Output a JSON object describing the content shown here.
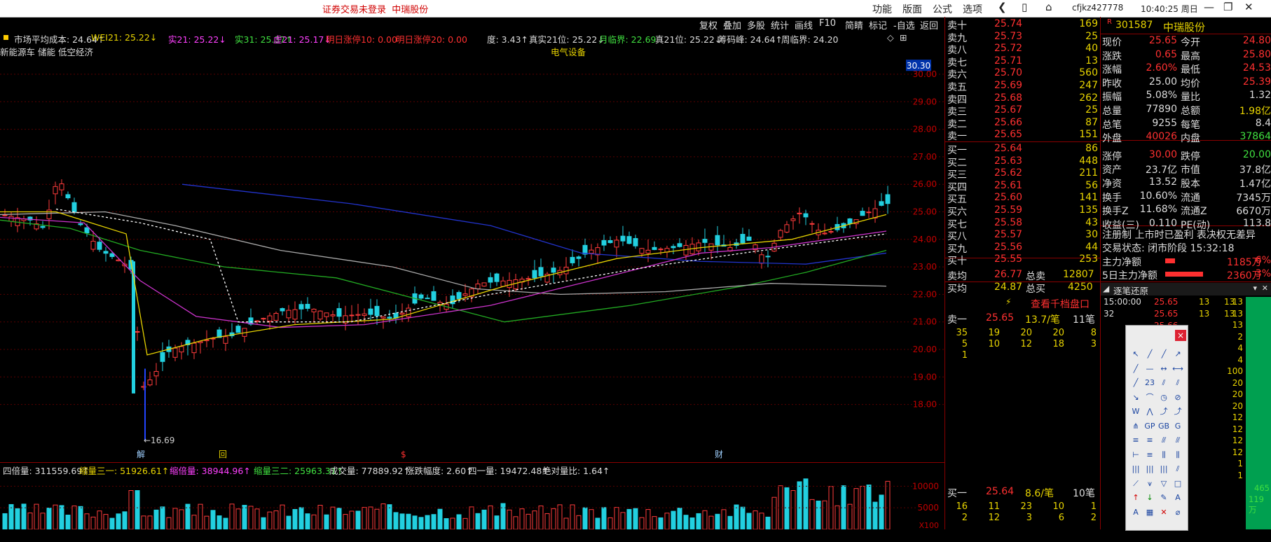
{
  "topbar": {
    "notice": "证券交易未登录",
    "stock_name": "中瑞股份",
    "menu": [
      "功能",
      "版面",
      "公式",
      "选项"
    ],
    "user": "cfjkz427778",
    "time": "10:40:25 周日",
    "window_buttons": [
      "❮",
      "▯",
      "⌂",
      "—",
      "❐",
      "✕"
    ]
  },
  "toolbar": [
    "复权",
    "叠加",
    "多股",
    "统计",
    "画线",
    "F10",
    "简睛",
    "标记",
    "-自选",
    "返回"
  ],
  "indicators": {
    "items": [
      {
        "text": "市场平均成本: 24.64↑",
        "color": "#dddddd"
      },
      {
        "text": "WEI21: 25.22↓",
        "color": "#e8d400"
      },
      {
        "text": "实21: 25.22↓",
        "color": "#ff40ff"
      },
      {
        "text": "实31: 25.37↑",
        "color": "#40e040"
      },
      {
        "text": "虚21: 25.17↓",
        "color": "#ff40ff"
      },
      {
        "text": "明日涨停10: 0.00",
        "color": "#ff3030"
      },
      {
        "text": "明日涨停20: 0.00",
        "color": "#ff3030"
      },
      {
        "text": "度: 3.43↑",
        "color": "#dddddd"
      },
      {
        "text": "真实21位: 25.22↓",
        "color": "#dddddd"
      },
      {
        "text": "月临界: 22.69",
        "color": "#40e040"
      },
      {
        "text": "真21位: 25.22↓",
        "color": "#dddddd"
      },
      {
        "text": "筹码峰: 24.64↑",
        "color": "#dddddd"
      },
      {
        "text": "周临界: 24.20",
        "color": "#dddddd"
      }
    ],
    "concepts": "新能源车 储能 低空经济",
    "sector": "电气设备"
  },
  "price_axis": {
    "ticks": [
      "30.00",
      "29.00",
      "28.00",
      "27.00",
      "26.00",
      "25.00",
      "24.00",
      "23.00",
      "22.00",
      "21.00",
      "20.00",
      "19.00",
      "18.00"
    ],
    "current": "30.30",
    "low_marker": "←16.69"
  },
  "volume_indicators": [
    {
      "text": "四倍量: 311559.69↑",
      "color": "#dddddd"
    },
    {
      "text": "缩量三一: 51926.61↑",
      "color": "#e8d400"
    },
    {
      "text": "缩倍量: 38944.96↑",
      "color": "#ff40ff"
    },
    {
      "text": "缩量三二: 25963.31↑",
      "color": "#40e040"
    },
    {
      "text": "成交量: 77889.92↑",
      "color": "#dddddd"
    },
    {
      "text": "涨跌幅度: 2.60↑",
      "color": "#dddddd"
    },
    {
      "text": "四一量: 19472.48↑",
      "color": "#dddddd"
    },
    {
      "text": "绝对量比: 1.64↑",
      "color": "#dddddd"
    }
  ],
  "volume_axis": {
    "ticks": [
      "10000",
      "5000"
    ],
    "unit": "X100"
  },
  "markers": [
    "解",
    "回",
    "$",
    "财"
  ],
  "orderbook": {
    "sell": [
      {
        "label": "卖十",
        "price": "25.74",
        "vol": "169"
      },
      {
        "label": "卖九",
        "price": "25.73",
        "vol": "25"
      },
      {
        "label": "卖八",
        "price": "25.72",
        "vol": "40"
      },
      {
        "label": "卖七",
        "price": "25.71",
        "vol": "13"
      },
      {
        "label": "卖六",
        "price": "25.70",
        "vol": "560"
      },
      {
        "label": "卖五",
        "price": "25.69",
        "vol": "247"
      },
      {
        "label": "卖四",
        "price": "25.68",
        "vol": "262"
      },
      {
        "label": "卖三",
        "price": "25.67",
        "vol": "25"
      },
      {
        "label": "卖二",
        "price": "25.66",
        "vol": "87"
      },
      {
        "label": "卖一",
        "price": "25.65",
        "vol": "151"
      }
    ],
    "buy": [
      {
        "label": "买一",
        "price": "25.64",
        "vol": "86"
      },
      {
        "label": "买二",
        "price": "25.63",
        "vol": "448"
      },
      {
        "label": "买三",
        "price": "25.62",
        "vol": "211"
      },
      {
        "label": "买四",
        "price": "25.61",
        "vol": "56"
      },
      {
        "label": "买五",
        "price": "25.60",
        "vol": "141"
      },
      {
        "label": "买六",
        "price": "25.59",
        "vol": "135"
      },
      {
        "label": "买七",
        "price": "25.58",
        "vol": "43"
      },
      {
        "label": "买八",
        "price": "25.57",
        "vol": "30"
      },
      {
        "label": "买九",
        "price": "25.56",
        "vol": "44"
      },
      {
        "label": "买十",
        "price": "25.55",
        "vol": "253"
      }
    ],
    "avg_sell_label": "卖均",
    "avg_sell": "26.77",
    "total_sell_label": "总卖",
    "total_sell": "12807",
    "avg_buy_label": "买均",
    "avg_buy": "24.87",
    "total_buy_label": "总买",
    "total_buy": "4250",
    "thousand_btn": "查看千档盘口",
    "sell1": {
      "label": "卖一",
      "price": "25.65",
      "per": "13.7/笔",
      "count": "11笔",
      "rows": [
        [
          "35",
          "19",
          "20",
          "20",
          "8"
        ],
        [
          "5",
          "10",
          "12",
          "18",
          "3"
        ],
        [
          "1",
          "",
          "",
          "",
          ""
        ]
      ]
    },
    "buy1": {
      "label": "买一",
      "price": "25.64",
      "per": "8.6/笔",
      "count": "10笔",
      "rows": [
        [
          "16",
          "11",
          "23",
          "10",
          "1"
        ],
        [
          "2",
          "12",
          "3",
          "6",
          "2"
        ]
      ]
    }
  },
  "quote": {
    "code": "301587",
    "name": "中瑞股份",
    "rows": [
      [
        "现价",
        "25.65",
        "今开",
        "24.80"
      ],
      [
        "涨跌",
        "0.65",
        "最高",
        "25.80"
      ],
      [
        "涨幅",
        "2.60%",
        "最低",
        "24.53"
      ],
      [
        "昨收",
        "25.00",
        "均价",
        "25.39"
      ],
      [
        "振幅",
        "5.08%",
        "量比",
        "1.32"
      ],
      [
        "总量",
        "77890",
        "总额",
        "1.98亿"
      ],
      [
        "总笔",
        "9255",
        "每笔",
        "8.4"
      ],
      [
        "外盘",
        "40026",
        "内盘",
        "37864"
      ],
      [
        "涨停",
        "30.00",
        "跌停",
        "20.00"
      ],
      [
        "资产",
        "23.7亿",
        "市值",
        "37.8亿"
      ],
      [
        "净资",
        "13.52",
        "股本",
        "1.47亿"
      ],
      [
        "换手",
        "10.60%",
        "流通",
        "7345万"
      ],
      [
        "换手Z",
        "11.68%",
        "流通Z",
        "6670万"
      ],
      [
        "收益(三)",
        "0.110",
        "PE(动)",
        "113.8"
      ]
    ],
    "register_note": "注册制 上市时已盈利 表决权无差异",
    "trade_state": "交易状态: 闭市阶段 15:32:18",
    "main_net_label": "主力净额",
    "main_net": "1185万",
    "main_net_pct": "6%",
    "main_net5_label": "5日主力净额",
    "main_net5": "2360万",
    "main_net5_pct": "3%"
  },
  "ticks_panel": {
    "title": "逐笔还原",
    "rows": [
      [
        "15:00:00",
        "25.65",
        "13",
        "13"
      ],
      [
        "32",
        "25.65",
        "13",
        "13"
      ],
      [
        "",
        "25.66",
        "",
        ""
      ]
    ],
    "right_col": [
      "13",
      "13",
      "13",
      "2",
      "4",
      "4",
      "100",
      "20",
      "20",
      "20",
      "12",
      "12",
      "12",
      "12",
      "1",
      "1"
    ],
    "bottom_vals": [
      "465",
      "119万"
    ]
  },
  "tool_glyphs": [
    "↖",
    "╱",
    "╱",
    "↗",
    "╱",
    "—",
    "↔",
    "⟷",
    "╱",
    "23",
    "⫽",
    "⫽",
    "↘",
    "⌒",
    "◷",
    "⊘",
    "W",
    "⋀",
    "⤴",
    "⤴",
    "⋔",
    "GP",
    "GB",
    "G",
    "≡",
    "≡",
    "⫻",
    "⫻",
    "⊢",
    "≡",
    "⫼",
    "⫼",
    "|||",
    "|||",
    "|||",
    "⫽",
    "⟋",
    "⩛",
    "▽",
    "□",
    "↑",
    "↓",
    "✎",
    "A",
    "A",
    "▦",
    "✕",
    "⌀"
  ]
}
